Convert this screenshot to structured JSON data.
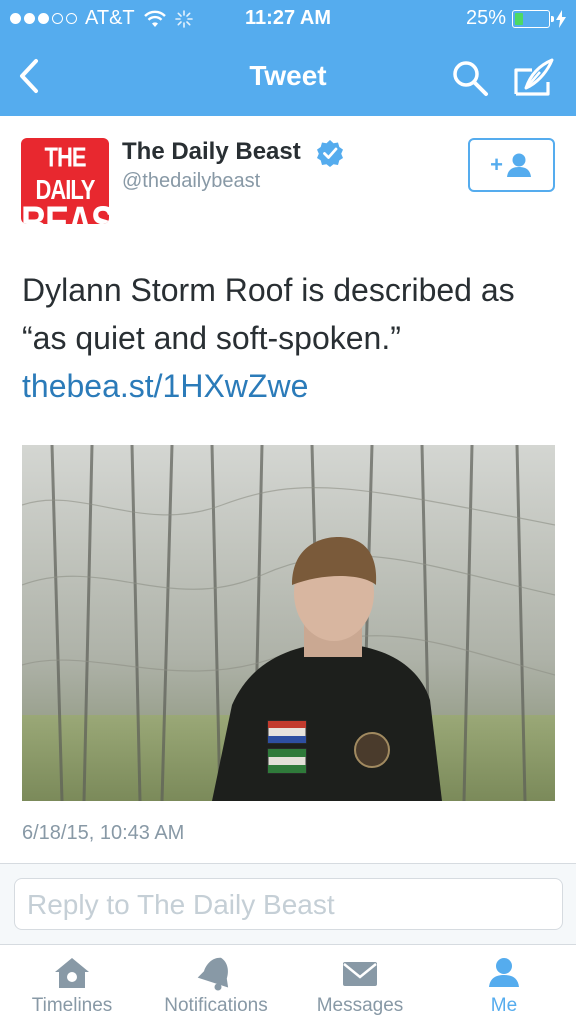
{
  "status_bar": {
    "carrier": "AT&T",
    "time": "11:27 AM",
    "battery": "25%",
    "battery_level": 0.25
  },
  "nav": {
    "title": "Tweet",
    "back_icon": "chevron-left-icon",
    "search_icon": "search-icon",
    "compose_icon": "compose-icon"
  },
  "tweet": {
    "author_name": "The Daily Beast",
    "handle": "@thedailybeast",
    "avatar_logo_text": [
      "THE DAILY",
      "BEAST"
    ],
    "follow_label": "+",
    "text": "Dylann Storm Roof is described as “as quiet and soft-spoken.”",
    "link": "thebea.st/1HXwZwe",
    "timestamp": "6/18/15, 10:43 AM"
  },
  "reply": {
    "placeholder": "Reply to The Daily Beast"
  },
  "tabs": [
    {
      "label": "Timelines",
      "icon": "home-icon",
      "active": false
    },
    {
      "label": "Notifications",
      "icon": "bell-icon",
      "active": false
    },
    {
      "label": "Messages",
      "icon": "envelope-icon",
      "active": false
    },
    {
      "label": "Me",
      "icon": "person-icon",
      "active": true
    }
  ],
  "colors": {
    "brand_blue": "#55acee",
    "link_blue": "#2b7bb9",
    "avatar_red": "#e8282f",
    "battery_green": "#4cd964"
  }
}
